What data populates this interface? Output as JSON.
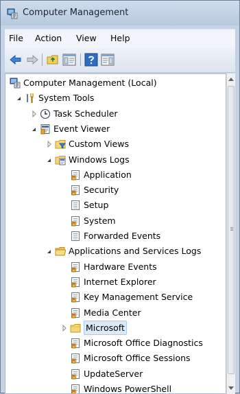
{
  "window": {
    "title": "Computer Management"
  },
  "menu": [
    "File",
    "Action",
    "View",
    "Help"
  ],
  "tree": [
    {
      "label": "Computer Management (Local)",
      "icon": "computer-management-icon",
      "expander": "none"
    },
    {
      "label": "System Tools",
      "icon": "tools-icon",
      "expander": "expanded"
    },
    {
      "label": "Task Scheduler",
      "icon": "clock-icon",
      "expander": "collapsed"
    },
    {
      "label": "Event Viewer",
      "icon": "event-viewer-icon",
      "expander": "expanded"
    },
    {
      "label": "Custom Views",
      "icon": "folder-filter-icon",
      "expander": "collapsed"
    },
    {
      "label": "Windows Logs",
      "icon": "folder-logs-icon",
      "expander": "expanded"
    },
    {
      "label": "Application",
      "icon": "log-icon",
      "expander": "none"
    },
    {
      "label": "Security",
      "icon": "log-icon",
      "expander": "none"
    },
    {
      "label": "Setup",
      "icon": "log-plain-icon",
      "expander": "none"
    },
    {
      "label": "System",
      "icon": "log-icon",
      "expander": "none"
    },
    {
      "label": "Forwarded Events",
      "icon": "log-plain-icon",
      "expander": "none"
    },
    {
      "label": "Applications and Services Logs",
      "icon": "folder-open-icon",
      "expander": "expanded"
    },
    {
      "label": "Hardware Events",
      "icon": "log-icon",
      "expander": "none"
    },
    {
      "label": "Internet Explorer",
      "icon": "log-icon",
      "expander": "none"
    },
    {
      "label": "Key Management Service",
      "icon": "log-icon",
      "expander": "none"
    },
    {
      "label": "Media Center",
      "icon": "log-icon",
      "expander": "none"
    },
    {
      "label": "Microsoft",
      "icon": "folder-icon",
      "expander": "collapsed",
      "selected": true
    },
    {
      "label": "Microsoft Office Diagnostics",
      "icon": "log-icon",
      "expander": "none"
    },
    {
      "label": "Microsoft Office Sessions",
      "icon": "log-icon",
      "expander": "none"
    },
    {
      "label": "UpdateServer",
      "icon": "log-icon",
      "expander": "none"
    },
    {
      "label": "Windows PowerShell",
      "icon": "log-icon",
      "expander": "none"
    }
  ]
}
